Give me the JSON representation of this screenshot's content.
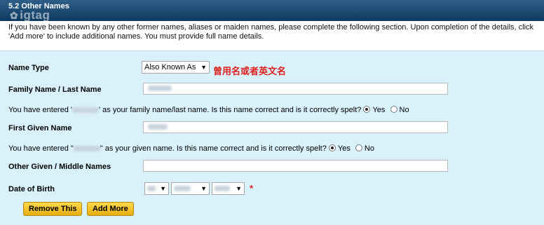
{
  "header": {
    "title": "5.2 Other Names",
    "watermark": "igtag"
  },
  "intro": "If you have been known by any other former names, aliases or maiden names, please complete the following section. Upon completion of the details, click 'Add more' to include additional names. You must provide full name details.",
  "form": {
    "name_type": {
      "label": "Name Type",
      "selected": "Also Known As",
      "note": "曾用名或者英文名"
    },
    "family_name": {
      "label": "Family Name / Last Name",
      "value": "Zhang"
    },
    "family_confirm": {
      "prefix": "You have entered '",
      "value": "ZHANG",
      "suffix": "' as your family name/last name. Is this name correct and is it correctly spelt?",
      "yes": "Yes",
      "no": "No",
      "selected": "Yes"
    },
    "first_name": {
      "label": "First Given Name",
      "value": "Roger"
    },
    "first_confirm": {
      "prefix": "You have entered \"",
      "value": "ROGER",
      "suffix": "\" as your given name. Is this name correct and is it correctly spelt?",
      "yes": "Yes",
      "no": "No",
      "selected": "Yes"
    },
    "other_names": {
      "label": "Other Given / Middle Names",
      "value": ""
    },
    "dob": {
      "label": "Date of Birth",
      "day": "01",
      "month": "JAN",
      "year": "1980",
      "required_mark": "*"
    }
  },
  "buttons": {
    "remove": "Remove This",
    "add": "Add More"
  }
}
